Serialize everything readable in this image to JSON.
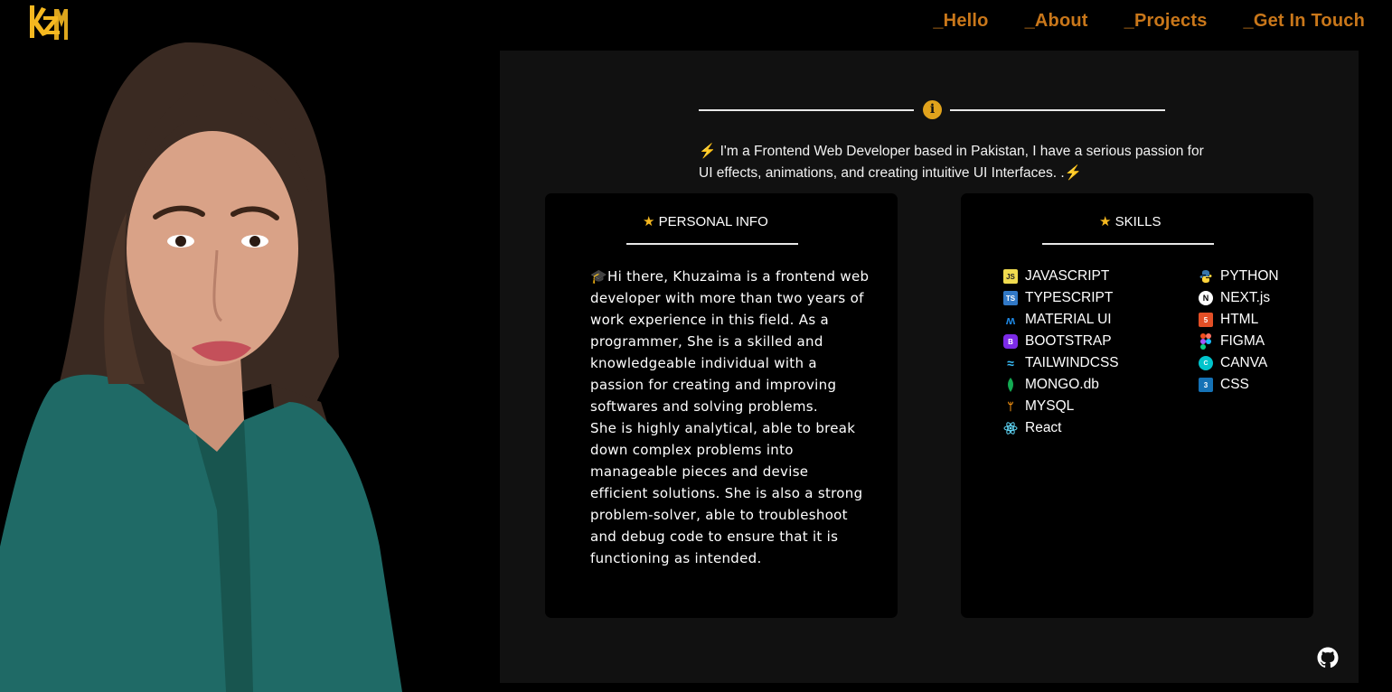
{
  "brand": {
    "logo_icon": "kzm-logo-icon",
    "accent": "#f5b820"
  },
  "nav": {
    "items": [
      {
        "label": "_Hello"
      },
      {
        "label": "_About"
      },
      {
        "label": "_Projects"
      },
      {
        "label": "_Get In Touch"
      }
    ],
    "color": "#c9771a"
  },
  "portrait": {
    "icon": "profile-portrait-image"
  },
  "about": {
    "divider_icon": "info-icon",
    "intro_bolt": "⚡",
    "intro": " I'm a Frontend Web Developer based in Pakistan, I have a serious passion for UI effects, animations, and creating intuitive UI Interfaces. .",
    "intro_end": "⚡"
  },
  "personal_info": {
    "star": "★",
    "title": " PERSONAL INFO",
    "bio_emoji": "🎓",
    "bio": "Hi there, Khuzaima is a frontend web developer with more than two years of work experience in this field. As a programmer, She is a skilled and knowledgeable individual with a passion for creating and improving softwares and solving problems.",
    "bio_2": "She is highly analytical, able to break down complex problems into manageable pieces and devise efficient solutions. She is also a strong problem-solver, able to troubleshoot and debug code to ensure that it is functioning as intended."
  },
  "skills": {
    "star": "★",
    "title": " SKILLS",
    "column_1": [
      {
        "label": "JAVASCRIPT",
        "icon": "javascript-icon"
      },
      {
        "label": "TYPESCRIPT",
        "icon": "typescript-icon"
      },
      {
        "label": "MATERIAL UI",
        "icon": "material-ui-icon"
      },
      {
        "label": "BOOTSTRAP",
        "icon": "bootstrap-icon"
      },
      {
        "label": "TAILWINDCSS",
        "icon": "tailwindcss-icon"
      },
      {
        "label": "MONGO.db",
        "icon": "mongodb-icon"
      },
      {
        "label": "MYSQL",
        "icon": "mysql-icon"
      },
      {
        "label": "React",
        "icon": "react-icon"
      }
    ],
    "column_2": [
      {
        "label": "PYTHON",
        "icon": "python-icon"
      },
      {
        "label": "NEXT.js",
        "icon": "nextjs-icon"
      },
      {
        "label": "HTML",
        "icon": "html5-icon"
      },
      {
        "label": "FIGMA",
        "icon": "figma-icon"
      },
      {
        "label": "CANVA",
        "icon": "canva-icon"
      },
      {
        "label": "CSS",
        "icon": "css3-icon"
      }
    ]
  },
  "footer": {
    "github_icon": "github-icon"
  }
}
